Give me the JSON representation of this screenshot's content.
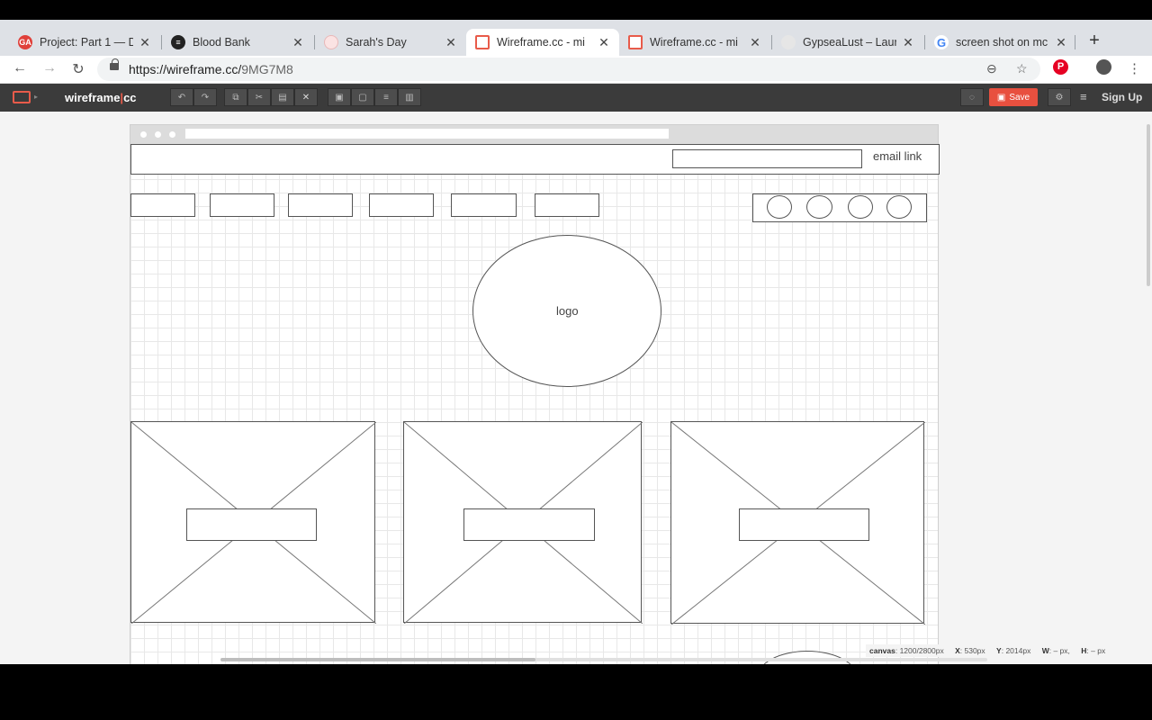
{
  "browser": {
    "tabs": [
      {
        "title": "Project: Part 1 — D",
        "icon": "ga-icon",
        "color": "#e0403a",
        "active": false
      },
      {
        "title": "Blood Bank",
        "icon": "spotify-icon",
        "color": "#222222",
        "active": false
      },
      {
        "title": "Sarah's Day",
        "icon": "circle-icon",
        "color": "#f3c6c6",
        "active": false
      },
      {
        "title": "Wireframe.cc - mi",
        "icon": "wireframe-icon",
        "color": "#e85b4a",
        "active": true
      },
      {
        "title": "Wireframe.cc - mi",
        "icon": "wireframe-icon",
        "color": "#e85b4a",
        "active": false
      },
      {
        "title": "GypseaLust – Laur",
        "icon": "blank-icon",
        "color": "#dddddd",
        "active": false
      },
      {
        "title": "screen shot on mc",
        "icon": "google-icon",
        "color": "#4285f4",
        "active": false
      }
    ],
    "url_host": "https://wireframe.cc/",
    "url_path": "9MG7M8"
  },
  "app": {
    "brand_main": "wireframe",
    "brand_bar": "|",
    "brand_end": "cc",
    "save_label": "Save",
    "signup_label": "Sign Up"
  },
  "wireframe": {
    "email_link_label": "email link",
    "logo_label": "logo",
    "nav_box_count": 6,
    "social_circle_count": 4,
    "image_placeholder_count": 3
  },
  "status": {
    "canvas_label": "canvas",
    "canvas_value": ": 1200/2800px",
    "x_label": "X",
    "x_value": ": 530px",
    "y_label": "Y",
    "y_value": ": 2014px",
    "w_label": "W",
    "w_value": ": – px,",
    "h_label": "H",
    "h_value": ": – px"
  }
}
